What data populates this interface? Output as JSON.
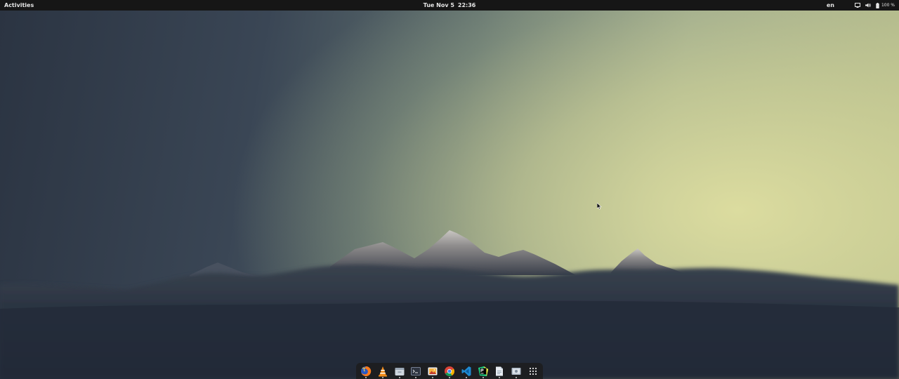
{
  "topbar": {
    "activities_label": "Activities",
    "date": "Tue Nov 5",
    "time": "22:36",
    "language": "en",
    "battery_percent": "100 %"
  },
  "tray_icons": [
    "screen-icon",
    "volume-icon",
    "battery-icon"
  ],
  "dock": {
    "items": [
      {
        "name": "firefox",
        "icon": "firefox-icon",
        "running": true
      },
      {
        "name": "vlc",
        "icon": "vlc-icon",
        "running": true
      },
      {
        "name": "files",
        "icon": "files-icon",
        "running": true
      },
      {
        "name": "terminal",
        "icon": "terminal-icon",
        "running": true
      },
      {
        "name": "image-viewer",
        "icon": "image-viewer-icon",
        "running": true
      },
      {
        "name": "chrome",
        "icon": "chrome-icon",
        "running": true
      },
      {
        "name": "vscode",
        "icon": "vscode-icon",
        "running": true
      },
      {
        "name": "pycharm",
        "icon": "pycharm-icon",
        "running": true
      },
      {
        "name": "text-editor",
        "icon": "text-editor-icon",
        "running": true
      },
      {
        "name": "screenshot",
        "icon": "screenshot-icon",
        "running": true
      },
      {
        "name": "show-applications",
        "icon": "app-grid-icon",
        "running": false
      }
    ]
  },
  "colors": {
    "topbar_bg": "#161616",
    "dock_bg": "#1c1c1c",
    "sky_dark": "#2b3442",
    "sky_light": "#c9c98f",
    "foreground_hills": "#27313f"
  }
}
